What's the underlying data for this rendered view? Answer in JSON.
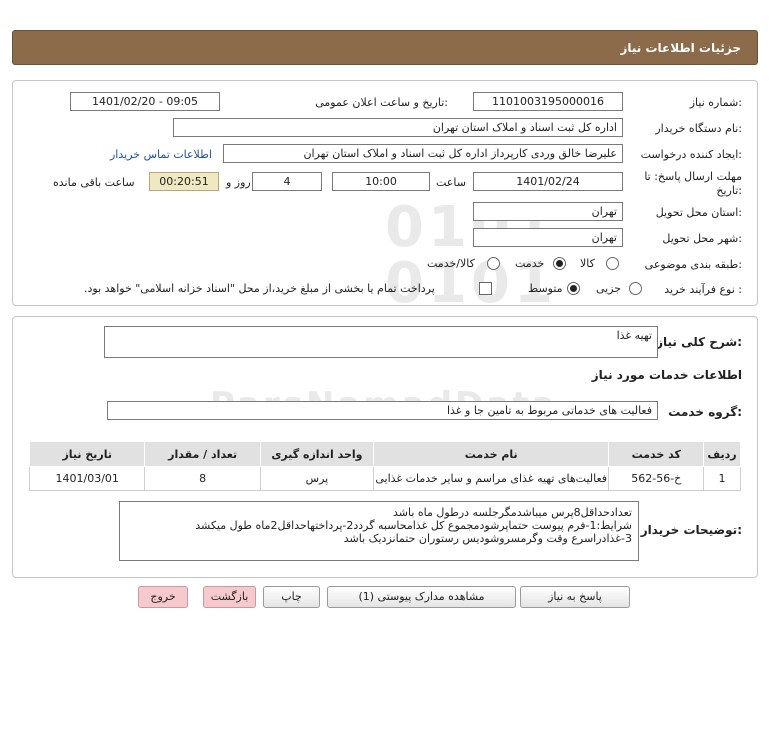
{
  "header": {
    "title": "جزئیات اطلاعات نیاز"
  },
  "form": {
    "need_number_label": "شماره نیاز:",
    "need_number": "1101003195000016",
    "announce_label": "تاریخ و ساعت اعلان عمومی:",
    "announce_value": "1401/02/20 - 09:05",
    "buyer_label": "نام دستگاه خریدار:",
    "buyer_value": "اداره کل ثبت اسناد و املاک استان تهران",
    "creator_label": "ایجاد کننده درخواست:",
    "creator_value": "علیرضا خالق وردی کارپرداز اداره کل ثبت اسناد و املاک استان تهران",
    "contact_link": "اطلاعات تماس خریدار",
    "deadline_label_1": "مهلت ارسال پاسخ: تا",
    "deadline_label_2": "تاریخ:",
    "deadline_date": "1401/02/24",
    "time_label": "ساعت",
    "deadline_time": "10:00",
    "days_value": "4",
    "days_label": "روز و",
    "remaining_time": "00:20:51",
    "remaining_label": "ساعت باقی مانده",
    "province_label": "استان محل تحویل:",
    "province_value": "تهران",
    "city_label": "شهر محل تحویل:",
    "city_value": "تهران",
    "category_label": "طبقه بندی موضوعی:",
    "category_options": [
      "کالا",
      "خدمت",
      "کالا/خدمت"
    ],
    "purchase_type_label": "نوع فرآیند خرید :",
    "purchase_options": [
      "جزیی",
      "متوسط"
    ],
    "payment_note": "پرداخت تمام یا بخشی از مبلغ خرید،از محل \"اسناد خزانه اسلامی\" خواهد بود."
  },
  "summary": {
    "label": "شرح کلی نیاز:",
    "value": "تهیه غذا",
    "services_heading": "اطلاعات خدمات مورد نیاز",
    "service_group_label": "گروه خدمت:",
    "service_group_value": "فعالیت های خدماتی مربوط به تامین جا و غذا"
  },
  "table": {
    "headers": [
      "ردیف",
      "کد خدمت",
      "نام خدمت",
      "واحد اندازه گیری",
      "تعداد / مقدار",
      "تاریخ نیاز"
    ],
    "rows": [
      [
        "1",
        "خ-56-562",
        "فعالیت‌های تهیه غذای مراسم و سایر خدمات غذایی",
        "پرس",
        "8",
        "1401/03/01"
      ]
    ]
  },
  "notes": {
    "label": "توضیحات خریدار:",
    "line1": "تعدادحداقل8پرس میباشدمگرجلسه درطول ماه باشد",
    "line2": "شرایط:1-فرم پیوست حتماپرشودمجموع کل غذامحاسبه گردد2-پرداختهاحداقل2ماه طول میکشد",
    "line3": "3-غذادراسرع وقت وگرمسروشودیس رستوران حتمانزدیک باشد"
  },
  "buttons": {
    "reply": "پاسخ به نیاز",
    "attachments": "مشاهده مدارک پیوستی (1)",
    "print": "چاپ",
    "back": "بازگشت",
    "exit": "خروج"
  },
  "colors": {
    "titlebar": "#8b6b4a",
    "exit_button": "#f6c9cc",
    "link": "#1a4fb5"
  }
}
